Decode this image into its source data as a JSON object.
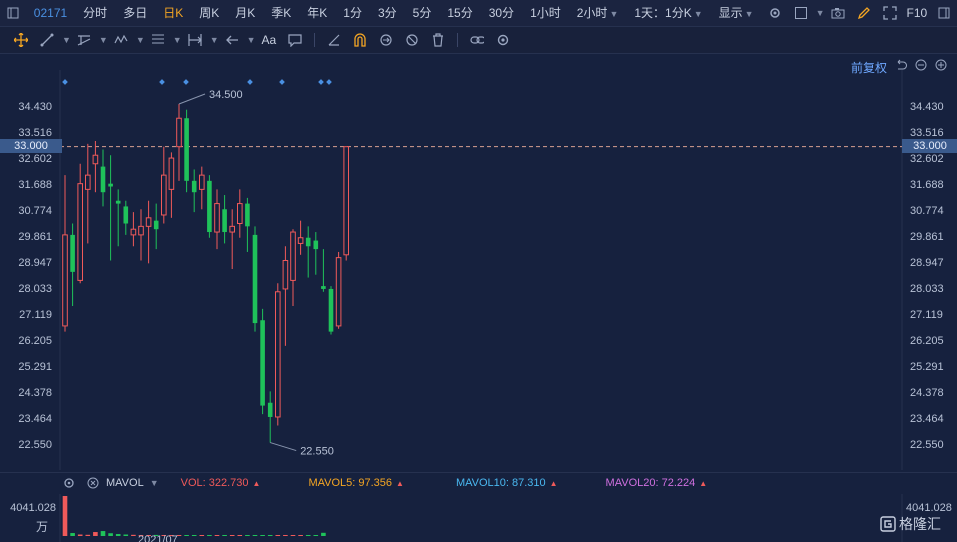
{
  "toolbar": {
    "code": "02171",
    "periods": [
      "分时",
      "多日",
      "日K",
      "周K",
      "月K",
      "季K",
      "年K",
      "1分",
      "3分",
      "5分",
      "15分",
      "30分",
      "1小时",
      "2小时"
    ],
    "active_period": "日K",
    "interval_select": "1天：1分K",
    "display_label": "显示",
    "fin_label": "F10"
  },
  "drawbar": {
    "text_tool": "Aa"
  },
  "chart_header": {
    "adjust_label": "前复权"
  },
  "price_axis": {
    "ticks": [
      "34.430",
      "33.516",
      "32.602",
      "31.688",
      "30.774",
      "29.861",
      "28.947",
      "28.033",
      "27.119",
      "26.205",
      "25.291",
      "24.378",
      "23.464",
      "22.550"
    ],
    "current_price": "33.000",
    "high_label": "34.500",
    "low_label": "22.550"
  },
  "volume": {
    "indicator": "MAVOL",
    "vol": "VOL: 322.730",
    "ma5": "MAVOL5: 97.356",
    "ma10": "MAVOL10: 87.310",
    "ma20": "MAVOL20: 72.224",
    "axis_value": "4041.028",
    "axis_unit": "万",
    "x_label": "2021/07",
    "colors": {
      "vol": "#f05a5a",
      "ma5": "#f5a623",
      "ma10": "#4ab8f0",
      "ma20": "#d070e0"
    }
  },
  "watermark": {
    "text": "格隆汇"
  },
  "chart_data": {
    "type": "candlestick",
    "ylim": [
      22.2,
      35.0
    ],
    "candles": [
      {
        "o": 26.7,
        "c": 29.9,
        "h": 32.0,
        "l": 26.5
      },
      {
        "o": 29.9,
        "c": 28.6,
        "h": 30.3,
        "l": 27.4
      },
      {
        "o": 28.3,
        "c": 31.7,
        "h": 32.4,
        "l": 28.2
      },
      {
        "o": 31.5,
        "c": 32.0,
        "h": 33.1,
        "l": 29.6
      },
      {
        "o": 32.4,
        "c": 32.7,
        "h": 33.2,
        "l": 31.4
      },
      {
        "o": 32.3,
        "c": 31.4,
        "h": 32.9,
        "l": 30.9
      },
      {
        "o": 31.7,
        "c": 31.6,
        "h": 32.7,
        "l": 29.0
      },
      {
        "o": 31.1,
        "c": 31.0,
        "h": 31.5,
        "l": 29.5
      },
      {
        "o": 30.9,
        "c": 30.3,
        "h": 31.1,
        "l": 29.9
      },
      {
        "o": 29.9,
        "c": 30.1,
        "h": 30.7,
        "l": 29.5
      },
      {
        "o": 29.9,
        "c": 30.2,
        "h": 30.8,
        "l": 29.0
      },
      {
        "o": 30.2,
        "c": 30.5,
        "h": 31.1,
        "l": 28.9
      },
      {
        "o": 30.4,
        "c": 30.1,
        "h": 31.0,
        "l": 29.4
      },
      {
        "o": 30.6,
        "c": 32.0,
        "h": 33.0,
        "l": 30.3
      },
      {
        "o": 31.5,
        "c": 32.6,
        "h": 32.8,
        "l": 30.5
      },
      {
        "o": 33.0,
        "c": 34.0,
        "h": 34.5,
        "l": 31.8
      },
      {
        "o": 34.0,
        "c": 31.8,
        "h": 34.3,
        "l": 31.4
      },
      {
        "o": 31.8,
        "c": 31.4,
        "h": 32.2,
        "l": 30.7
      },
      {
        "o": 31.5,
        "c": 32.0,
        "h": 32.3,
        "l": 30.8
      },
      {
        "o": 31.8,
        "c": 30.0,
        "h": 32.0,
        "l": 29.8
      },
      {
        "o": 30.0,
        "c": 31.0,
        "h": 31.5,
        "l": 29.4
      },
      {
        "o": 30.8,
        "c": 30.0,
        "h": 31.3,
        "l": 29.6
      },
      {
        "o": 30.0,
        "c": 30.2,
        "h": 30.8,
        "l": 28.7
      },
      {
        "o": 30.3,
        "c": 31.0,
        "h": 31.5,
        "l": 29.8
      },
      {
        "o": 31.0,
        "c": 30.2,
        "h": 31.2,
        "l": 29.3
      },
      {
        "o": 29.9,
        "c": 26.8,
        "h": 30.2,
        "l": 26.5
      },
      {
        "o": 26.9,
        "c": 23.9,
        "h": 27.3,
        "l": 23.6
      },
      {
        "o": 24.0,
        "c": 23.5,
        "h": 24.4,
        "l": 22.6
      },
      {
        "o": 23.5,
        "c": 27.9,
        "h": 28.2,
        "l": 23.2
      },
      {
        "o": 28.0,
        "c": 29.0,
        "h": 29.5,
        "l": 26.0
      },
      {
        "o": 28.3,
        "c": 30.0,
        "h": 30.1,
        "l": 27.4
      },
      {
        "o": 29.6,
        "c": 29.8,
        "h": 30.4,
        "l": 29.2
      },
      {
        "o": 29.8,
        "c": 29.5,
        "h": 30.2,
        "l": 28.4
      },
      {
        "o": 29.7,
        "c": 29.4,
        "h": 30.0,
        "l": 28.5
      },
      {
        "o": 28.1,
        "c": 28.0,
        "h": 29.4,
        "l": 27.9
      },
      {
        "o": 28.0,
        "c": 26.5,
        "h": 28.1,
        "l": 26.4
      },
      {
        "o": 26.7,
        "c": 29.1,
        "h": 29.3,
        "l": 26.6
      },
      {
        "o": 29.2,
        "c": 33.0,
        "h": 33.0,
        "l": 29.0
      }
    ],
    "volume_max": 4041.028,
    "volumes": [
      4041,
      300,
      150,
      120,
      400,
      500,
      280,
      200,
      150,
      120,
      100,
      90,
      110,
      80,
      70,
      60,
      50,
      40,
      60,
      45,
      40,
      35,
      30,
      30,
      25,
      30,
      40,
      35,
      30,
      25,
      20,
      25,
      20,
      30,
      322
    ]
  }
}
